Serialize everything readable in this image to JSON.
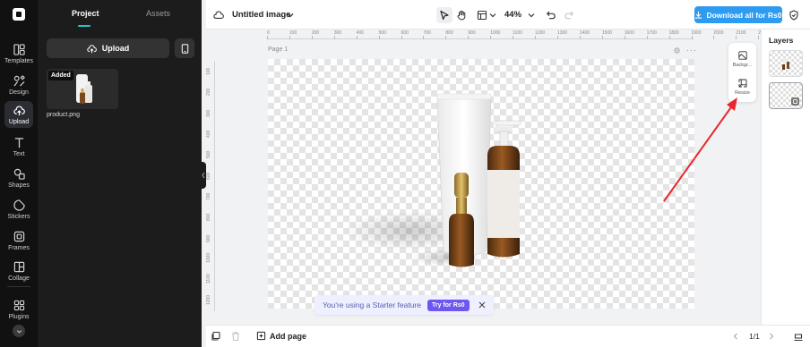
{
  "sidebar": {
    "items": [
      {
        "label": "Templates",
        "icon": "templates-icon"
      },
      {
        "label": "Design",
        "icon": "design-icon"
      },
      {
        "label": "Upload",
        "icon": "upload-cloud-icon",
        "active": true
      },
      {
        "label": "Text",
        "icon": "text-icon"
      },
      {
        "label": "Shapes",
        "icon": "shapes-icon"
      },
      {
        "label": "Stickers",
        "icon": "stickers-icon"
      },
      {
        "label": "Frames",
        "icon": "frames-icon"
      },
      {
        "label": "Collage",
        "icon": "collage-icon"
      },
      {
        "label": "Plugins",
        "icon": "plugins-icon"
      }
    ]
  },
  "panel": {
    "tabs": [
      {
        "label": "Project",
        "active": true
      },
      {
        "label": "Assets",
        "active": false
      }
    ],
    "upload_label": "Upload",
    "asset": {
      "badge": "Added",
      "name": "product.png"
    }
  },
  "topbar": {
    "title": "Untitled image",
    "zoom": "44%",
    "download_label": "Download all for Rs0"
  },
  "ruler": {
    "h_ticks": [
      "0",
      "100",
      "200",
      "300",
      "400",
      "500",
      "600",
      "700",
      "800",
      "900",
      "1000",
      "1100",
      "1200",
      "1300",
      "1400",
      "1500",
      "1600",
      "1700",
      "1800",
      "1900",
      "2000",
      "2100",
      "2200",
      "2300"
    ],
    "v_ticks": [
      "100",
      "200",
      "300",
      "400",
      "500",
      "600",
      "700",
      "800",
      "900",
      "1000",
      "1100",
      "1200"
    ]
  },
  "canvas": {
    "page_label": "Page 1"
  },
  "side_tools": [
    {
      "label": "Backgr...",
      "icon": "background-icon"
    },
    {
      "label": "Resize",
      "icon": "resize-icon"
    }
  ],
  "layers": {
    "title": "Layers"
  },
  "toast": {
    "text": "You're using a Starter feature",
    "button": "Try for Rs0"
  },
  "bottombar": {
    "add_page": "Add page",
    "page_count": "1/1"
  },
  "colors": {
    "accent": "#2d9bf0",
    "teal": "#22c4c9",
    "starter_purple": "#6e56f0",
    "annotation_arrow": "#e8262b"
  }
}
